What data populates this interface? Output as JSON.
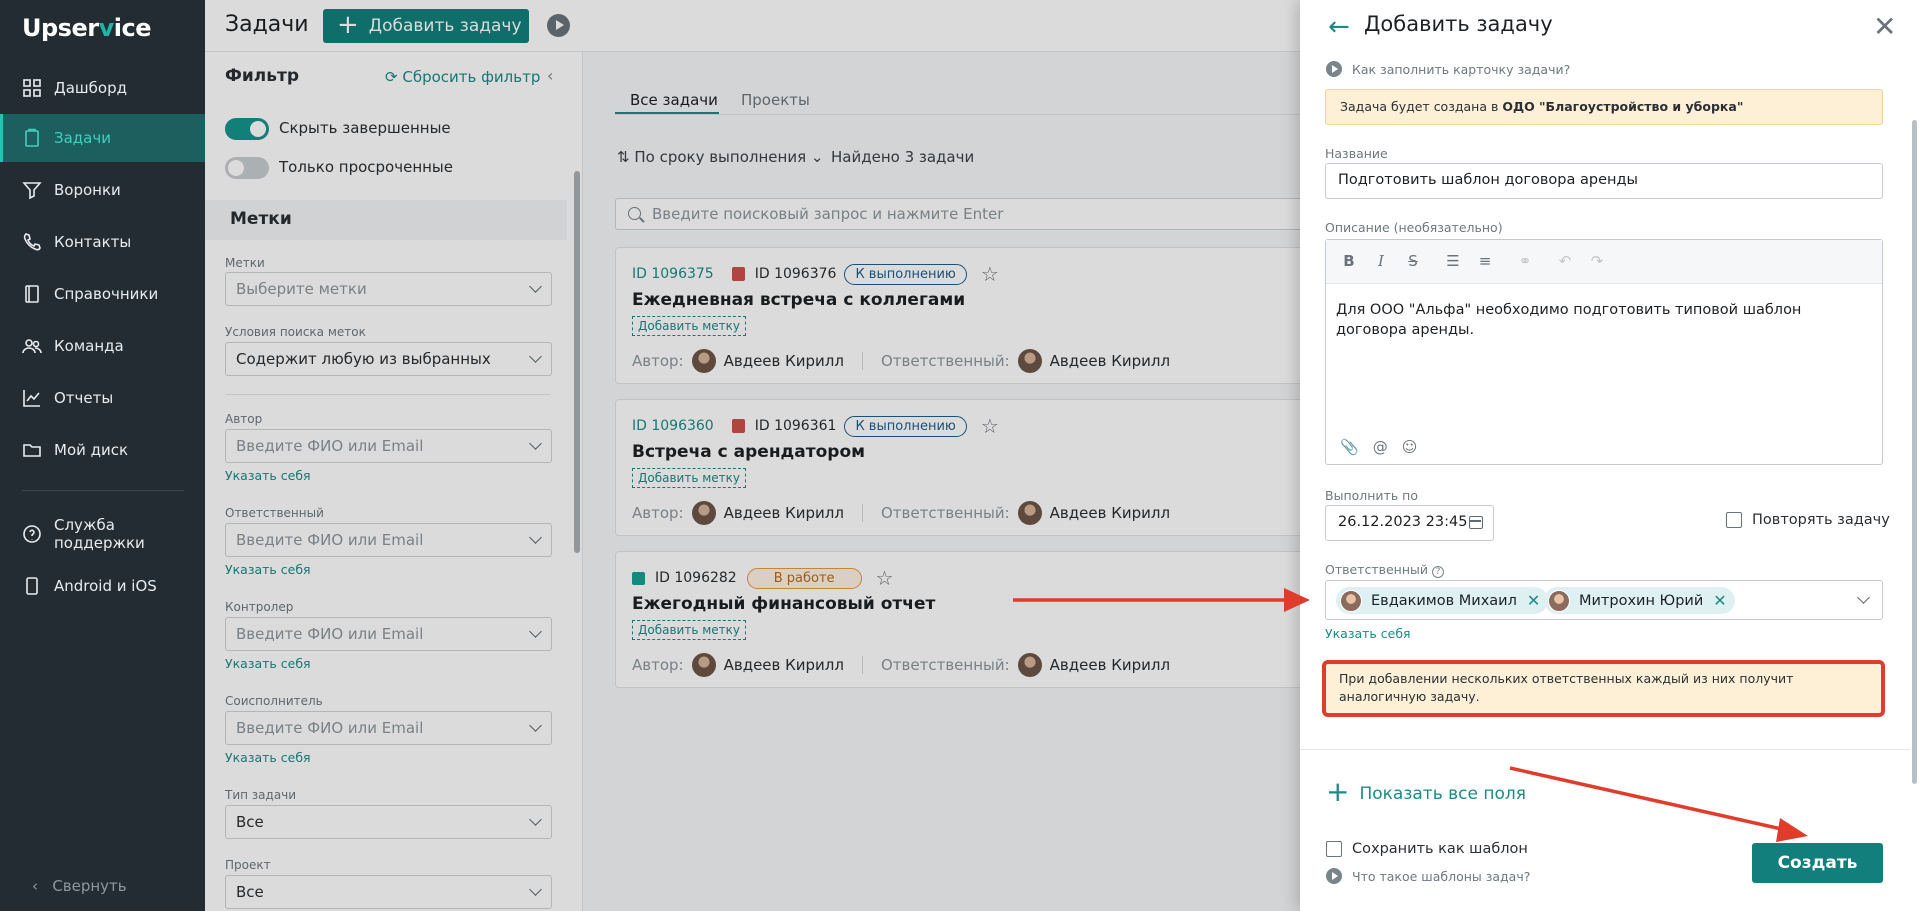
{
  "brand": {
    "logo_pre": "Upser",
    "logo_v": "v",
    "logo_post": "ice"
  },
  "nav": {
    "items": [
      {
        "label": "Дашборд",
        "icon": "dashboard-icon"
      },
      {
        "label": "Задачи",
        "icon": "tasks-icon",
        "active": true
      },
      {
        "label": "Воронки",
        "icon": "funnel-icon"
      },
      {
        "label": "Контакты",
        "icon": "phone-icon"
      },
      {
        "label": "Справочники",
        "icon": "book-icon"
      },
      {
        "label": "Команда",
        "icon": "team-icon"
      },
      {
        "label": "Отчеты",
        "icon": "chart-icon"
      },
      {
        "label": "Мой диск",
        "icon": "folder-icon"
      }
    ],
    "support": "Служба поддержки",
    "mobile": "Android и iOS",
    "collapse": "Свернуть"
  },
  "header": {
    "title": "Задачи",
    "add_button": "Добавить задачу"
  },
  "filter": {
    "title": "Фильтр",
    "reset": "Сбросить фильтр",
    "toggle_hide_done": "Скрыть завершенные",
    "toggle_overdue": "Только просроченные",
    "section_tags": "Метки",
    "tags_label": "Метки",
    "tags_placeholder": "Выберите метки",
    "cond_label": "Условия поиска меток",
    "cond_value": "Содержит любую из выбранных",
    "author_label": "Автор",
    "resp_label": "Ответственный",
    "controller_label": "Контролер",
    "coexec_label": "Соисполнитель",
    "person_placeholder": "Введите ФИО или Email",
    "set_self": "Указать себя",
    "type_label": "Тип задачи",
    "type_value": "Все",
    "project_label": "Проект",
    "project_value": "Все"
  },
  "tasks": {
    "tab_all": "Все задачи",
    "tab_projects": "Проекты",
    "sort": "По сроку выполнения",
    "found": "Найдено 3 задачи",
    "search_placeholder": "Введите поисковый запрос и нажмите Enter",
    "add_tag": "Добавить метку",
    "author_lbl": "Автор:",
    "resp_lbl": "Ответственный:",
    "cards": [
      {
        "id1": "ID 1096375",
        "id2": "ID 1096376",
        "status": "К выполнению",
        "title": "Ежедневная встреча с коллегами",
        "author": "Авдеев Кирилл",
        "resp": "Авдеев Кирилл"
      },
      {
        "id1": "ID 1096360",
        "id2": "ID 1096361",
        "status": "К выполнению",
        "title": "Встреча с арендатором",
        "author": "Авдеев Кирилл",
        "resp": "Авдеев Кирилл"
      },
      {
        "id2": "ID 1096282",
        "status": "В работе",
        "title": "Ежегодный финансовый отчет",
        "author": "Авдеев Кирилл",
        "resp": "Авдеев Кирилл"
      }
    ]
  },
  "drawer": {
    "title": "Добавить задачу",
    "hint_card": "Как заполнить карточку задачи?",
    "notice_pre": "Задача будет создана в ",
    "notice_org": "ОДО \"Благоустройство и уборка\"",
    "name_label": "Название",
    "name_value": "Подготовить шаблон договора аренды",
    "desc_label": "Описание (необязательно)",
    "desc_value": "Для ООО \"Альфа\" необходимо подготовить типовой шаблон договора аренды.",
    "due_label": "Выполнить по",
    "due_value": "26.12.2023 23:45",
    "repeat_label": "Повторять задачу",
    "resp_label": "Ответственный",
    "resp_chips": [
      "Евдакимов Михаил",
      "Митрохин Юрий"
    ],
    "set_self": "Указать себя",
    "warn": "При добавлении нескольких ответственных каждый из них получит аналогичную задачу.",
    "show_all": "Показать все поля",
    "save_template": "Сохранить как шаблон",
    "hint_templates": "Что такое шаблоны задач?",
    "create": "Создать"
  },
  "colors": {
    "accent": "#127f7c",
    "nav_bg": "#232c33",
    "warn_border": "#e03c2c",
    "arrow": "#e03c2c"
  }
}
